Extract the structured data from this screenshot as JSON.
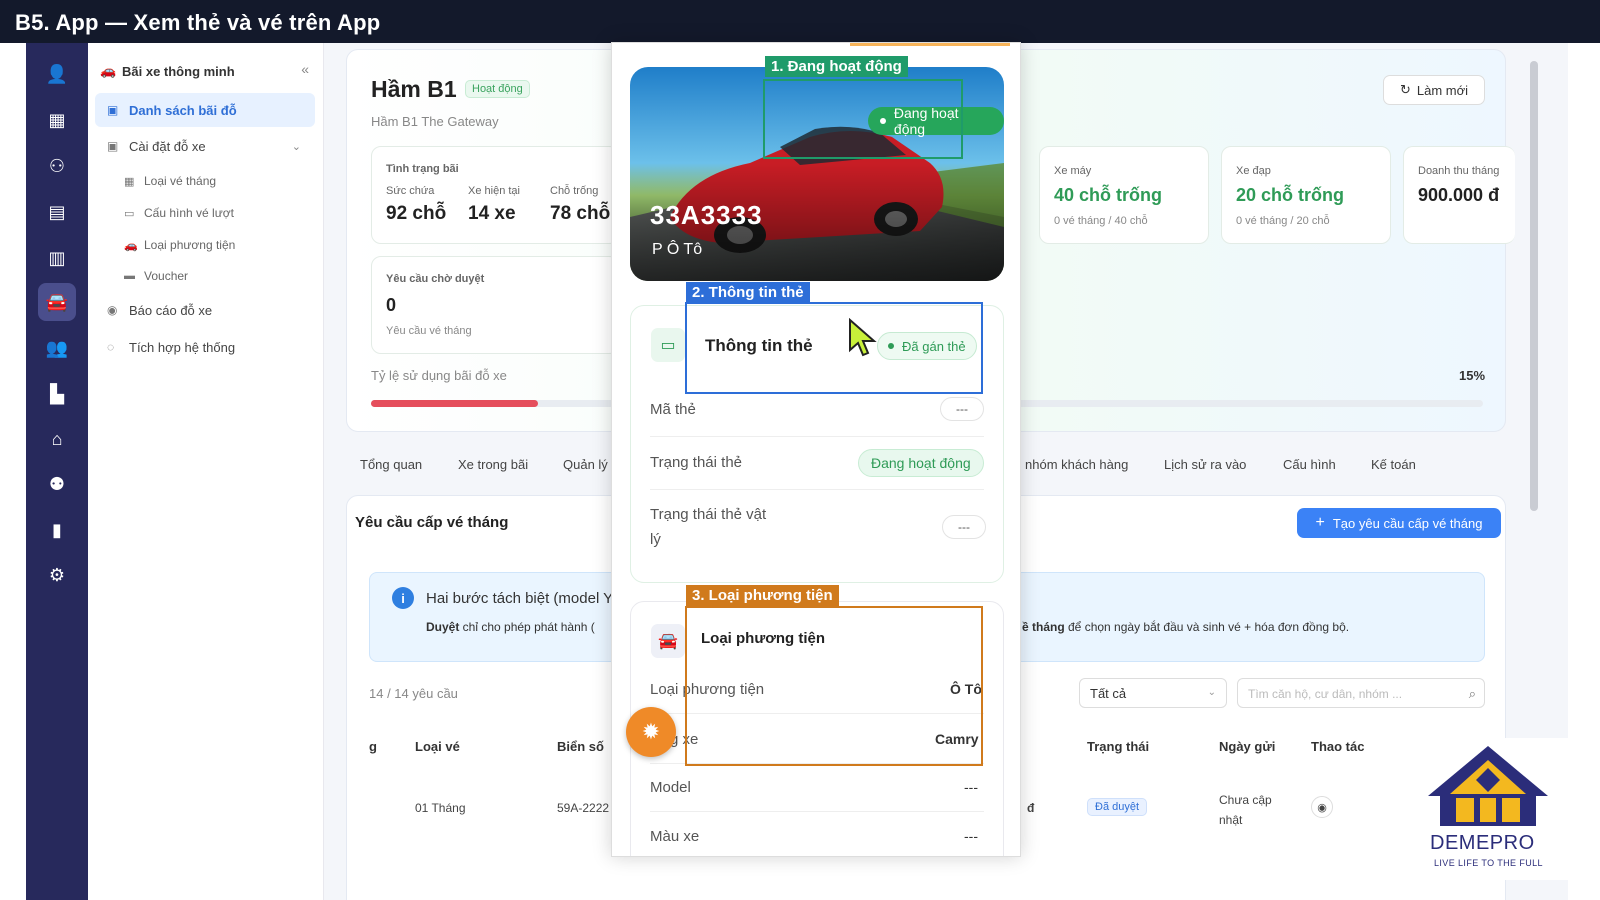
{
  "topbar": {
    "title": "B5. App — Xem thẻ và vé trên App"
  },
  "rail": {
    "icons": [
      "user-icon",
      "building-icon",
      "flow-icon",
      "calculator-icon",
      "clipboard-icon",
      "car-icon",
      "users-icon",
      "city-icon",
      "store-icon",
      "person-icon",
      "chart-icon",
      "gear-icon"
    ],
    "active_color": "#f7c32e"
  },
  "sidebar": {
    "header": "Bãi xe thông minh",
    "items": [
      {
        "label": "Danh sách bãi đỗ"
      },
      {
        "label": "Cài đặt đỗ xe"
      },
      {
        "label": "Báo cáo đỗ xe"
      },
      {
        "label": "Tích hợp hệ thống"
      }
    ],
    "subitems": [
      {
        "label": "Loại vé tháng"
      },
      {
        "label": "Cấu hình vé lượt"
      },
      {
        "label": "Loại phương tiện"
      },
      {
        "label": "Voucher"
      }
    ]
  },
  "park": {
    "title": "Hầm B1",
    "badge": "Hoạt động",
    "subtitle": "Hầm B1 The Gateway",
    "refresh": "Làm mới",
    "status_box": {
      "label": "Tình trạng bãi",
      "capacity_lbl": "Sức chứa",
      "capacity_val": "92 chỗ",
      "current_lbl": "Xe hiện tại",
      "current_val": "14 xe",
      "empty_lbl": "Chỗ trống",
      "empty_val": "78 chỗ"
    },
    "pending": {
      "label": "Yêu cầu chờ duyệt",
      "value": "0",
      "note": "Yêu cầu vé tháng"
    },
    "motorbike": {
      "label": "Xe máy",
      "value": "40 chỗ trống",
      "note": "0 vé tháng / 40 chỗ"
    },
    "bicycle": {
      "label": "Xe đạp",
      "value": "20 chỗ trống",
      "note": "0 vé tháng / 20 chỗ"
    },
    "revenue": {
      "label": "Doanh thu tháng",
      "value": "900.000 đ"
    },
    "usage_label": "Tỷ lệ sử dụng bãi đỗ xe",
    "usage_pct": "15%",
    "usage_fraction": 0.15
  },
  "tabs": {
    "left": [
      "Tổng quan",
      "Xe trong bãi",
      "Quản lý"
    ],
    "right": [
      "nhóm khách hàng",
      "Lịch sử ra vào",
      "Cấu hình",
      "Kế toán"
    ]
  },
  "requests": {
    "title": "Yêu cầu cấp vé tháng",
    "create_btn": "Tạo yêu cầu cấp vé tháng",
    "info_title": "Hai bước tách biệt (model Y",
    "info_bold": "Duyệt",
    "info_text": " chỉ cho phép phát hành (",
    "info_right_bold": "ề tháng",
    "info_right_text": " để chọn ngày bắt đầu và sinh vé + hóa đơn đồng bộ.",
    "count": "14 / 14 yêu cầu",
    "filter": "Tất cả",
    "search_placeholder": "Tìm căn hộ, cư dân, nhóm ...",
    "headers": {
      "g": "g",
      "ticket": "Loại vé",
      "plate": "Biển số",
      "status": "Trạng thái",
      "date": "Ngày gửi",
      "action": "Thao tác"
    },
    "row": {
      "ticket": "01 Tháng",
      "plate": "59A-2222",
      "d": "đ",
      "status": "Đã duyệt",
      "date": "Chưa cập nhật"
    }
  },
  "phone": {
    "plate": "33A3333",
    "car_type": "P  Ô Tô",
    "active_badge": "Đang hoạt động",
    "card_section": {
      "title": "Thông tin thẻ",
      "tag": "Đã gán thẻ",
      "rows": [
        {
          "label": "Mã thẻ",
          "value": "---"
        },
        {
          "label": "Trạng thái thẻ",
          "value": "Đang hoạt động"
        },
        {
          "label": "Trạng thái thẻ vật",
          "label2": "lý",
          "value": "---"
        }
      ]
    },
    "vehicle_section": {
      "title": "Loại phương tiện",
      "rows": [
        {
          "label": "Loại phương tiện",
          "value": "Ô Tô"
        },
        {
          "label": "g xe",
          "value": "Camry"
        },
        {
          "label": "Model",
          "value": "---"
        },
        {
          "label": "Màu xe",
          "value": "---"
        }
      ]
    }
  },
  "annotations": [
    {
      "label": "1. Đang hoạt động",
      "color": "#1f9b6a"
    },
    {
      "label": "2. Thông tin thẻ",
      "color": "#2d6ed8"
    },
    {
      "label": "3. Loại phương tiện",
      "color": "#d07a1c"
    }
  ],
  "logo": {
    "name": "DEMEPRO",
    "slogan": "LIVE LIFE TO THE FULL",
    "color": "#2b2d7a"
  }
}
